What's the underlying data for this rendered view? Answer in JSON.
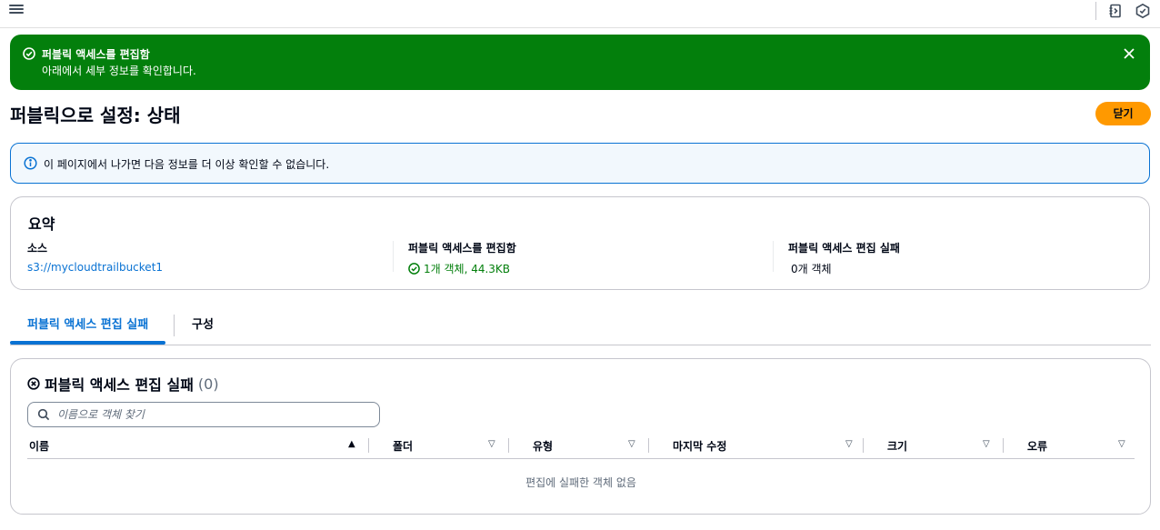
{
  "icons": {
    "menu": "hamburger-menu-icon",
    "topbar_right": [
      "notebook-icon",
      "settings-hex-icon"
    ],
    "flash_status": "check-circle-icon",
    "flash_close": "close-icon",
    "info": "info-circle-icon",
    "failed_status": "x-circle-icon",
    "search": "search-icon"
  },
  "colors": {
    "success": "#037f0c",
    "primary": "#0972d3",
    "accent_button": "#ff9900"
  },
  "flash": {
    "title": "퍼블릭 액세스를 편집함",
    "description": "아래에서 세부 정보를 확인합니다."
  },
  "page": {
    "title": "퍼블릭으로 설정: 상태",
    "close_button": "닫기"
  },
  "info_alert": {
    "text": "이 페이지에서 나가면 다음 정보를 더 이상 확인할 수 없습니다."
  },
  "summary": {
    "heading": "요약",
    "source_label": "소스",
    "source_value": "s3://mycloudtrailbucket1",
    "succeeded_label": "퍼블릭 액세스를 편집함",
    "succeeded_value": "1개 객체, 44.3KB",
    "failed_label": "퍼블릭 액세스 편집 실패",
    "failed_value": "0개 객체"
  },
  "tabs": [
    {
      "label": "퍼블릭 액세스 편집 실패",
      "active": true
    },
    {
      "label": "구성",
      "active": false
    }
  ],
  "failed_table": {
    "heading": "퍼블릭 액세스 편집 실패",
    "count": "(0)",
    "search_placeholder": "이름으로 객체 찾기",
    "columns": [
      "이름",
      "폴더",
      "유형",
      "마지막 수정",
      "크기",
      "오류"
    ],
    "sort_indicators": [
      "▲",
      "▽",
      "▽",
      "▽",
      "▽",
      "▽"
    ],
    "empty_message": "편집에 실패한 객체 없음"
  }
}
